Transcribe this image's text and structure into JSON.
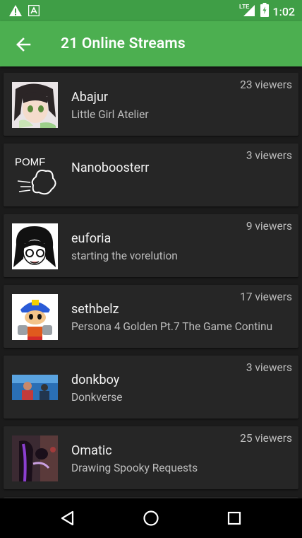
{
  "status_bar": {
    "time": "1:02",
    "network": "LTE"
  },
  "app_bar": {
    "title": "21 Online Streams"
  },
  "streams": [
    {
      "name": "Abajur",
      "subtitle": "Little Girl Atelier",
      "viewers": "23 viewers"
    },
    {
      "name": "Nanoboosterr",
      "subtitle": "",
      "viewers": "3 viewers",
      "thumb_text": "POMF"
    },
    {
      "name": "euforia",
      "subtitle": "starting the vorelution",
      "viewers": "9 viewers"
    },
    {
      "name": "sethbelz",
      "subtitle": " Persona 4 Golden Pt.7 The Game Continu",
      "viewers": "17 viewers"
    },
    {
      "name": "donkboy",
      "subtitle": "Donkverse",
      "viewers": "3 viewers"
    },
    {
      "name": "Omatic",
      "subtitle": "Drawing Spooky Requests",
      "viewers": "25 viewers"
    }
  ],
  "colors": {
    "status_bar": "#3f9e46",
    "app_bar": "#4caf50",
    "card": "#262626",
    "background": "#1b1b1b"
  }
}
